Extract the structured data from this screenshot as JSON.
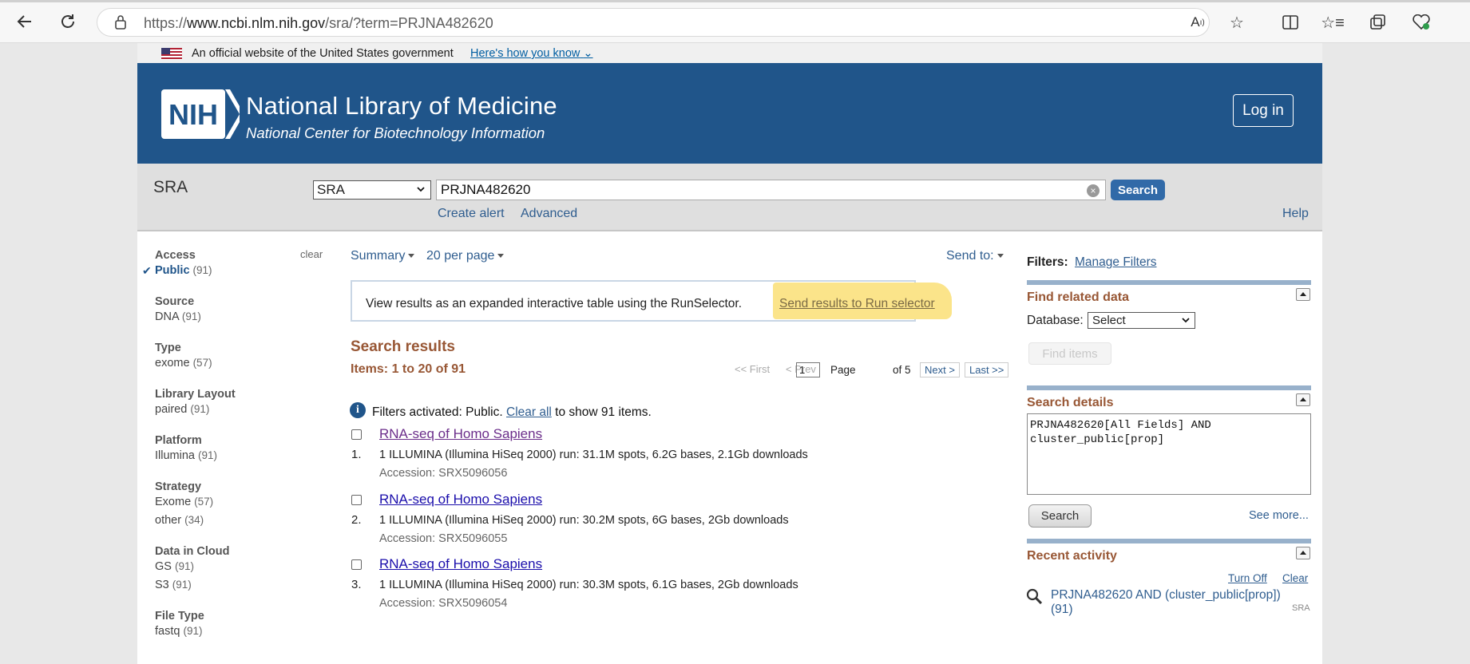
{
  "browser": {
    "url_prefix": "https://",
    "url_host": "www.ncbi.nlm.nih.gov",
    "url_path": "/sra/?term=PRJNA482620"
  },
  "gov_banner": {
    "text": "An official website of the United States government",
    "link": "Here's how you know"
  },
  "header": {
    "logo": "NIH",
    "title": "National Library of Medicine",
    "subtitle": "National Center for Biotechnology Information",
    "login": "Log in"
  },
  "search": {
    "db_name": "SRA",
    "db_select_value": "SRA",
    "term": "PRJNA482620",
    "button": "Search",
    "create_alert": "Create alert",
    "advanced": "Advanced",
    "help": "Help"
  },
  "filters": {
    "clear": "clear",
    "groups": [
      {
        "title": "Access",
        "items": [
          {
            "label": "Public",
            "count": "(91)"
          }
        ]
      },
      {
        "title": "Source",
        "items": [
          {
            "label": "DNA",
            "count": "(91)"
          }
        ]
      },
      {
        "title": "Type",
        "items": [
          {
            "label": "exome",
            "count": "(57)"
          }
        ]
      },
      {
        "title": "Library Layout",
        "items": [
          {
            "label": "paired",
            "count": "(91)"
          }
        ]
      },
      {
        "title": "Platform",
        "items": [
          {
            "label": "Illumina",
            "count": "(91)"
          }
        ]
      },
      {
        "title": "Strategy",
        "items": [
          {
            "label": "Exome",
            "count": "(57)"
          },
          {
            "label": "other",
            "count": "(34)"
          }
        ]
      },
      {
        "title": "Data in Cloud",
        "items": [
          {
            "label": "GS",
            "count": "(91)"
          },
          {
            "label": "S3",
            "count": "(91)"
          }
        ]
      },
      {
        "title": "File Type",
        "items": [
          {
            "label": "fastq",
            "count": "(91)"
          }
        ]
      }
    ]
  },
  "controls": {
    "summary": "Summary",
    "per_page": "20 per page",
    "send_to": "Send to:"
  },
  "runselector": {
    "text": "View results as an expanded interactive table using the RunSelector.",
    "link": "Send results to Run selector"
  },
  "results": {
    "title": "Search results",
    "items": "Items: 1 to 20 of 91",
    "pager": {
      "first": "<< First",
      "prev": "< Prev",
      "page_label": "Page",
      "page_value": "1",
      "of": "of 5",
      "next": "Next >",
      "last": "Last >>"
    },
    "filters_activated_pre": "Filters activated: Public.",
    "clear_all": "Clear all",
    "filters_activated_post": "to show 91 items.",
    "list": [
      {
        "num": "1.",
        "title": "RNA-seq of Homo Sapiens",
        "desc": "1 ILLUMINA (Illumina HiSeq 2000) run: 31.1M spots, 6.2G bases, 2.1Gb downloads",
        "accession": "Accession: SRX5096056"
      },
      {
        "num": "2.",
        "title": "RNA-seq of Homo Sapiens",
        "desc": "1 ILLUMINA (Illumina HiSeq 2000) run: 30.2M spots, 6G bases, 2Gb downloads",
        "accession": "Accession: SRX5096055"
      },
      {
        "num": "3.",
        "title": "RNA-seq of Homo Sapiens",
        "desc": "1 ILLUMINA (Illumina HiSeq 2000) run: 30.3M spots, 6.1G bases, 2Gb downloads",
        "accession": "Accession: SRX5096054"
      }
    ]
  },
  "right": {
    "filters_label": "Filters:",
    "manage_filters": "Manage Filters",
    "find_related": "Find related data",
    "database_label": "Database:",
    "database_value": "Select",
    "find_items": "Find items",
    "search_details": "Search details",
    "details_text": "PRJNA482620[All Fields] AND\ncluster_public[prop]",
    "details_search": "Search",
    "see_more": "See more...",
    "recent_activity": "Recent activity",
    "turn_off": "Turn Off",
    "clear": "Clear",
    "recent_item": "PRJNA482620 AND (cluster_public[prop]) (91)",
    "recent_db": "SRA"
  },
  "colors": {
    "header_blue": "#20558a",
    "section_brown": "#985735",
    "link_blue": "#2f5d8f",
    "highlight_yellow": "#fbe48a"
  }
}
